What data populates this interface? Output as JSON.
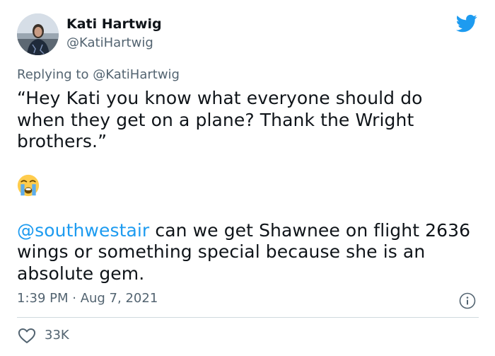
{
  "author": {
    "display_name": "Kati Hartwig",
    "handle": "@KatiHartwig"
  },
  "reply": {
    "prefix": "Replying to",
    "to_handle": "@KatiHartwig"
  },
  "body": {
    "quote_lines": [
      "“Hey Kati you know what everyone should do",
      "when they get on a plane? Thank the Wright",
      "brothers.”"
    ],
    "emoji": "loudly-crying-face",
    "mention": "@southwestair",
    "line1_rest": " can we get Shawnee on flight 2636",
    "line2": "wings or something special because she is an",
    "line3": "absolute gem."
  },
  "meta": {
    "timestamp": "1:39 PM · Aug 7, 2021"
  },
  "actions": {
    "like_count": "33K"
  },
  "icons": {
    "brand": "twitter-bird-icon",
    "info": "info-icon",
    "like": "heart-icon"
  },
  "colors": {
    "accent": "#1d9bf0",
    "text": "#0f1419",
    "muted": "#536471",
    "divider": "#cfd9de"
  }
}
